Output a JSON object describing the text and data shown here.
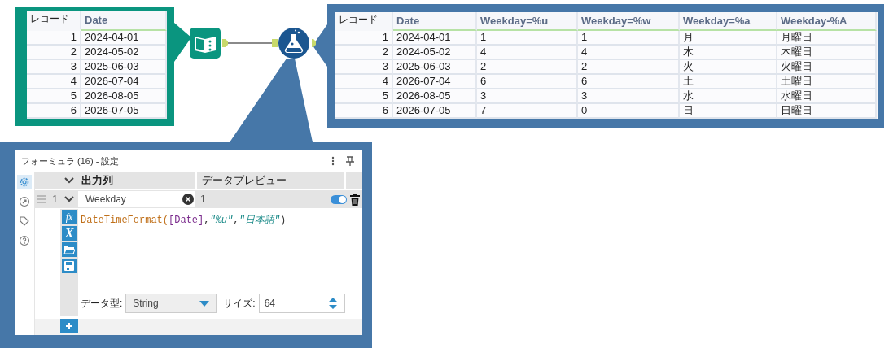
{
  "input_preview": {
    "columns": [
      "レコード",
      "Date"
    ],
    "rows": [
      [
        "1",
        "2024-04-01"
      ],
      [
        "2",
        "2024-05-02"
      ],
      [
        "3",
        "2025-06-03"
      ],
      [
        "4",
        "2026-07-04"
      ],
      [
        "5",
        "2026-08-05"
      ],
      [
        "6",
        "2026-07-05"
      ]
    ]
  },
  "workflow": {
    "tools": [
      {
        "kind": "input"
      },
      {
        "kind": "formula"
      }
    ]
  },
  "output_preview": {
    "columns": [
      "レコード",
      "Date",
      "Weekday=%u",
      "Weekday=%w",
      "Weekday=%a",
      "Weekday-%A"
    ],
    "rows": [
      [
        "1",
        "2024-04-01",
        "1",
        "1",
        "月",
        "月曜日"
      ],
      [
        "2",
        "2024-05-02",
        "4",
        "4",
        "木",
        "木曜日"
      ],
      [
        "3",
        "2025-06-03",
        "2",
        "2",
        "火",
        "火曜日"
      ],
      [
        "4",
        "2026-07-04",
        "6",
        "6",
        "土",
        "土曜日"
      ],
      [
        "5",
        "2026-08-05",
        "3",
        "3",
        "水",
        "水曜日"
      ],
      [
        "6",
        "2026-07-05",
        "7",
        "0",
        "日",
        "日曜日"
      ]
    ]
  },
  "config_panel": {
    "title": "フォーミュラ (16) - 設定",
    "sidebar": [
      {
        "kind": "settings",
        "selected": true
      },
      {
        "kind": "arrow",
        "selected": false
      },
      {
        "kind": "tag",
        "selected": false
      },
      {
        "kind": "help",
        "selected": false
      }
    ],
    "columns": [
      "出力列",
      "データプレビュー"
    ],
    "formulas": [
      {
        "number": "1",
        "output_column": "Weekday",
        "preview": "1",
        "enabled": true,
        "expression": [
          {
            "kind": "function",
            "text": "DateTimeFormat("
          },
          {
            "kind": "field",
            "text": "[Date]"
          },
          {
            "kind": "plain",
            "text": ","
          },
          {
            "kind": "string",
            "text": "\"%u\""
          },
          {
            "kind": "plain",
            "text": ","
          },
          {
            "kind": "string",
            "text": "\"日本語\""
          },
          {
            "kind": "plain",
            "text": ")"
          }
        ],
        "tool_buttons": [
          {
            "kind": "function",
            "glyph": "fx"
          },
          {
            "kind": "variable",
            "glyph": "X"
          },
          {
            "kind": "folder"
          },
          {
            "kind": "save"
          }
        ],
        "data_type_label": "データ型:",
        "data_type": "String",
        "size_label": "サイズ:",
        "size": "64"
      }
    ]
  }
}
